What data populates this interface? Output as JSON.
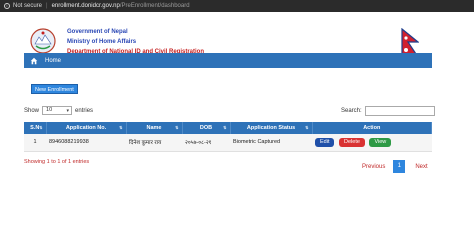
{
  "browser": {
    "secure_label": "Not secure",
    "url_host": "enrollment.donidcr.gov.np",
    "url_path": "/PreEnrollment/dashboard"
  },
  "header": {
    "gov": "Government of Nepal",
    "ministry": "Ministry of Home Affairs",
    "dept": "Department of National ID and Civil Registration"
  },
  "nav": {
    "home_label": "Home"
  },
  "new_enrollment_label": "New Enrollment",
  "entries": {
    "show_label": "Show",
    "selected": "10",
    "entries_label": "entries"
  },
  "search": {
    "label": "Search:"
  },
  "table": {
    "headers": [
      "S.N",
      "Application No.",
      "Name",
      "DOB",
      "Application Status",
      "Action"
    ],
    "rows": [
      {
        "sn": "1",
        "app_no": "8946088219938",
        "name": "दिनेश कुमार राय",
        "dob": "२०५७-०८-२१",
        "status": "Biometric Captured"
      }
    ],
    "actions": {
      "edit": "Edit",
      "delete": "Delete",
      "view": "View"
    }
  },
  "info": "Showing 1 to 1 of 1 entries",
  "pagination": {
    "previous": "Previous",
    "page": "1",
    "next": "Next"
  },
  "colors": {
    "primary": "#2e72b8",
    "brand_blue": "#2b48b5",
    "brand_red": "#c41e1e",
    "edit": "#1f4fa8",
    "delete": "#d93232",
    "view": "#2e9a45"
  }
}
